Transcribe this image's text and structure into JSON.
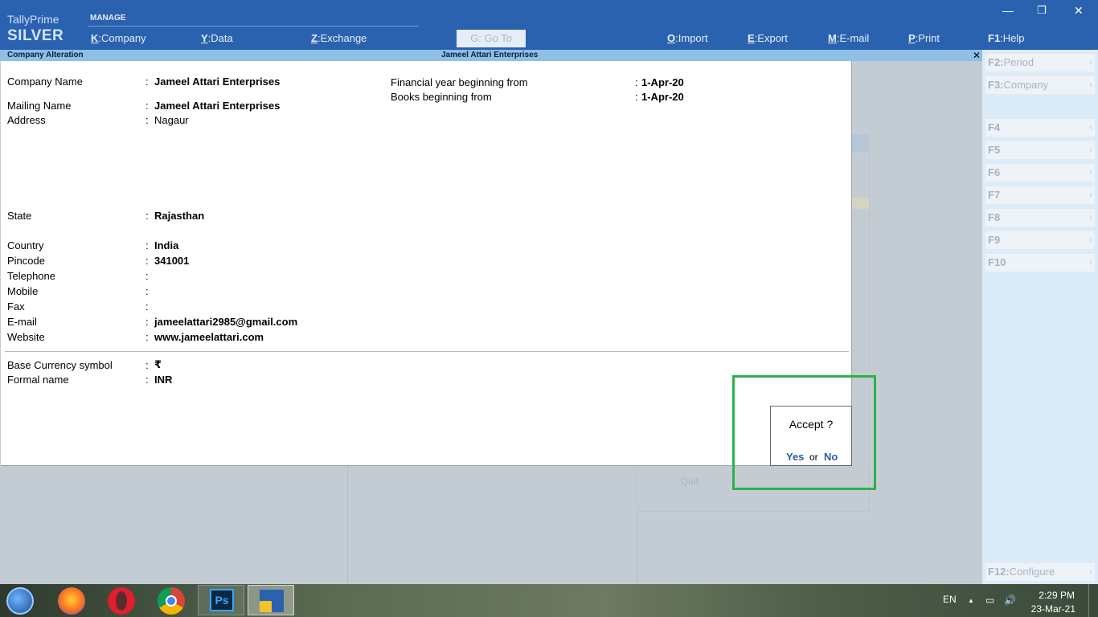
{
  "app": {
    "brand_top": "TallyPrime",
    "brand_edition": "SILVER",
    "manage_label": "MANAGE",
    "menu": [
      {
        "key": "K",
        "label": "Company"
      },
      {
        "key": "Y",
        "label": "Data"
      },
      {
        "key": "Z",
        "label": "Exchange"
      },
      {
        "key": "G",
        "label": "Go To"
      },
      {
        "key": "O",
        "label": "Import"
      },
      {
        "key": "E",
        "label": "Export"
      },
      {
        "key": "M",
        "label": "E-mail"
      },
      {
        "key": "P",
        "label": "Print"
      },
      {
        "key": "F1",
        "label": "Help"
      }
    ],
    "window_controls": {
      "minimize": "—",
      "restore": "❐",
      "close": "✕"
    }
  },
  "screen": {
    "title_left": "Company  Alteration",
    "title_center": "Jameel Attari Enterprises",
    "close_glyph": "✕"
  },
  "form": {
    "left_fields": [
      {
        "label": "Company Name",
        "value": "Jameel Attari Enterprises"
      },
      {
        "label": "Mailing Name",
        "value": "Jameel Attari Enterprises"
      },
      {
        "label": "Address",
        "value": "Nagaur"
      },
      {
        "label": "State",
        "value": "Rajasthan"
      },
      {
        "label": "Country",
        "value": "India"
      },
      {
        "label": "Pincode",
        "value": "341001"
      },
      {
        "label": "Telephone",
        "value": ""
      },
      {
        "label": "Mobile",
        "value": ""
      },
      {
        "label": "Fax",
        "value": ""
      },
      {
        "label": "E-mail",
        "value": "jameelattari2985@gmail.com"
      },
      {
        "label": "Website",
        "value": "www.jameelattari.com"
      },
      {
        "label": "Base Currency symbol",
        "value": "₹"
      },
      {
        "label": "Formal name",
        "value": "INR"
      }
    ],
    "right_fields": [
      {
        "label": "Financial year beginning from",
        "value": "1-Apr-20"
      },
      {
        "label": "Books beginning from",
        "value": "1-Apr-20"
      }
    ],
    "colon": ":"
  },
  "dialog": {
    "question": "Accept ?",
    "yes": "Yes",
    "or": "or",
    "no": "No"
  },
  "background": {
    "quit_label": "Quit"
  },
  "right_panel": {
    "buttons": [
      {
        "key": "F2:",
        "label": "Period"
      },
      {
        "key": "F3:",
        "label": "Company"
      },
      {
        "key": "F4",
        "label": ""
      },
      {
        "key": "F5",
        "label": ""
      },
      {
        "key": "F6",
        "label": ""
      },
      {
        "key": "F7",
        "label": ""
      },
      {
        "key": "F8",
        "label": ""
      },
      {
        "key": "F9",
        "label": ""
      },
      {
        "key": "F10",
        "label": ""
      }
    ],
    "configure": {
      "key": "F12:",
      "label": "Configure"
    },
    "chevron": "‹"
  },
  "taskbar": {
    "apps": [
      "start-button",
      "firefox",
      "opera",
      "chrome",
      "photoshop",
      "tallyprime"
    ],
    "ps_label": "Ps",
    "language": "EN",
    "tray_up": "▲",
    "tray_network": "▭",
    "tray_volume": "🔊",
    "time": "2:29 PM",
    "date": "23-Mar-21"
  }
}
